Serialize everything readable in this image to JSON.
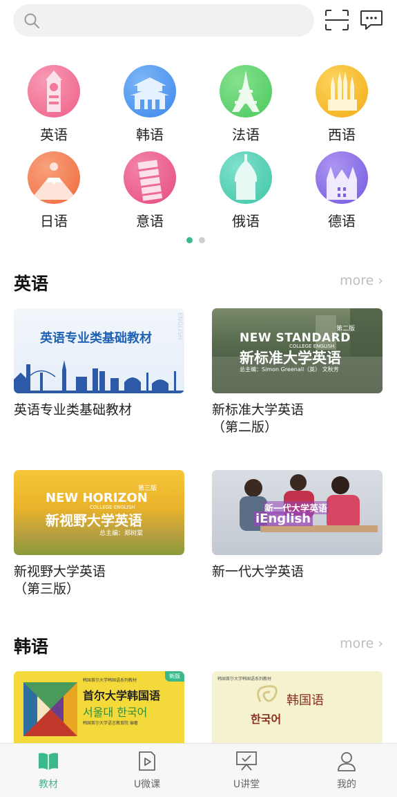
{
  "colors": {
    "accent": "#3cb98a",
    "dot_inactive": "#cfcfcf",
    "more": "#bdbdbd"
  },
  "topbar": {
    "search_icon": "search-icon",
    "scan_icon": "scan-icon",
    "message_icon": "message-icon"
  },
  "languages": [
    {
      "label": "英语",
      "icon": "big-ben-icon",
      "color": "#f06d8f"
    },
    {
      "label": "韩语",
      "icon": "palace-icon",
      "color": "#4a97f0"
    },
    {
      "label": "法语",
      "icon": "eiffel-tower-icon",
      "color": "#5bd36b"
    },
    {
      "label": "西语",
      "icon": "sagrada-familia-icon",
      "color": "#f5b826"
    },
    {
      "label": "日语",
      "icon": "mount-fuji-icon",
      "color": "#f3794a"
    },
    {
      "label": "意语",
      "icon": "pisa-tower-icon",
      "color": "#ec5a8c"
    },
    {
      "label": "俄语",
      "icon": "onion-dome-icon",
      "color": "#4fcdb3"
    },
    {
      "label": "德语",
      "icon": "castle-icon",
      "color": "#8a6ee6"
    }
  ],
  "sections": [
    {
      "title": "英语",
      "more": "more",
      "books": [
        {
          "title": "英语专业类基础教材",
          "cover_text": "英语专业类基础教材",
          "cover_side": "ENGLISH"
        },
        {
          "title": "新标准大学英语\n（第二版）",
          "cover_brand": "NEW STANDARD",
          "cover_sub": "COLLEGE ENGLISH",
          "cover_edition": "第二版",
          "cover_title": "新标准大学英语",
          "cover_editor": "总主编：Simon Greenall（英） 文秋芳"
        },
        {
          "title": "新视野大学英语\n（第三版）",
          "cover_brand": "NEW HORIZON",
          "cover_sub": "COLLEGE ENGLISH",
          "cover_edition": "第三版",
          "cover_title": "新视野大学英语",
          "cover_editor": "总主编：郑树棠"
        },
        {
          "title": "新一代大学英语",
          "cover_title": "新一代大学英语",
          "cover_brand": "iEnglish"
        }
      ]
    },
    {
      "title": "韩语",
      "more": "more",
      "books": [
        {
          "title": "",
          "cover_series": "韩国首尔大学韩国语系列教材",
          "cover_title": "首尔大学韩国语",
          "cover_korean": "서울대 한국어",
          "cover_badge": "新版",
          "cover_publisher": "韩国首尔大学语言教育院 编著"
        },
        {
          "title": "",
          "cover_series": "韩国首尔大学韩国语系列教材",
          "cover_title": "韩国语",
          "cover_korean": "한국어"
        }
      ]
    }
  ],
  "bottom_nav": [
    {
      "label": "教材",
      "icon": "book-icon",
      "active": true
    },
    {
      "label": "U微课",
      "icon": "video-icon",
      "active": false
    },
    {
      "label": "U讲堂",
      "icon": "lecture-icon",
      "active": false
    },
    {
      "label": "我的",
      "icon": "profile-icon",
      "active": false
    }
  ]
}
